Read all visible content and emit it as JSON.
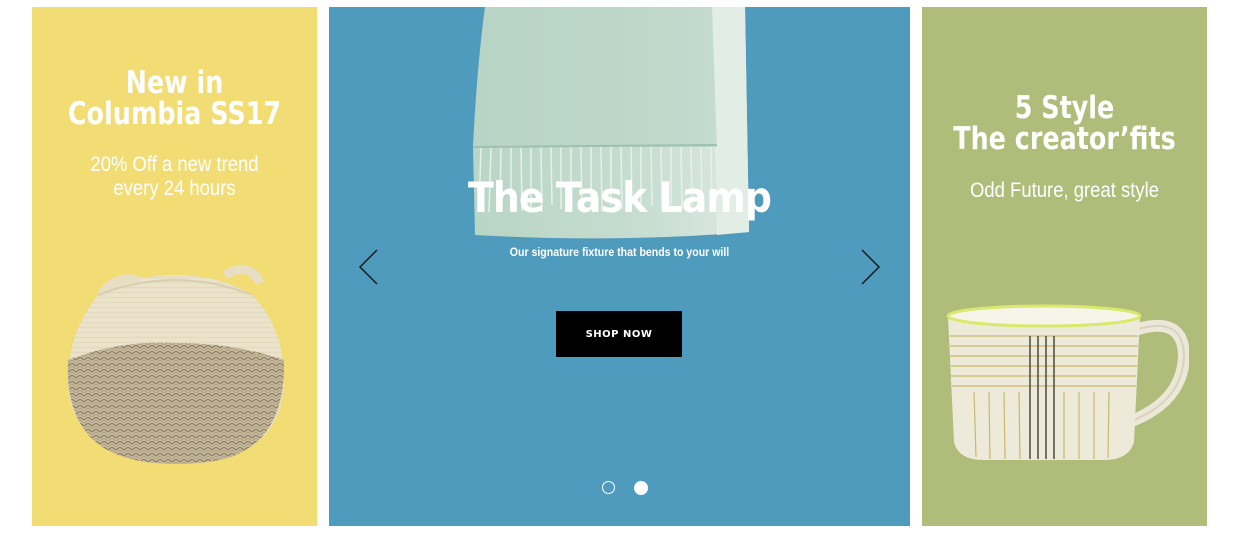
{
  "colors": {
    "left_panel": "#f2dc74",
    "center_panel": "#4f9bbd",
    "right_panel": "#b0bd7a",
    "button_bg": "#000000",
    "text": "#ffffff"
  },
  "left_panel": {
    "title_line1": "New in",
    "title_line2": "Columbia SS17",
    "subtitle_line1": "20% Off a new trend",
    "subtitle_line2": "every 24 hours",
    "image": "woven-basket"
  },
  "hero": {
    "title": "The Task Lamp",
    "subtitle": "Our signature fixture that bends to your will",
    "button_label": "SHOP NOW",
    "image": "folded-towel",
    "prev_icon": "chevron-left-icon",
    "next_icon": "chevron-right-icon",
    "slides_total": 2,
    "active_slide": 2
  },
  "right_panel": {
    "title_line1": "5 Style",
    "title_line2": "The creator’fits",
    "subtitle": "Odd Future, great style",
    "image": "striped-mug"
  }
}
